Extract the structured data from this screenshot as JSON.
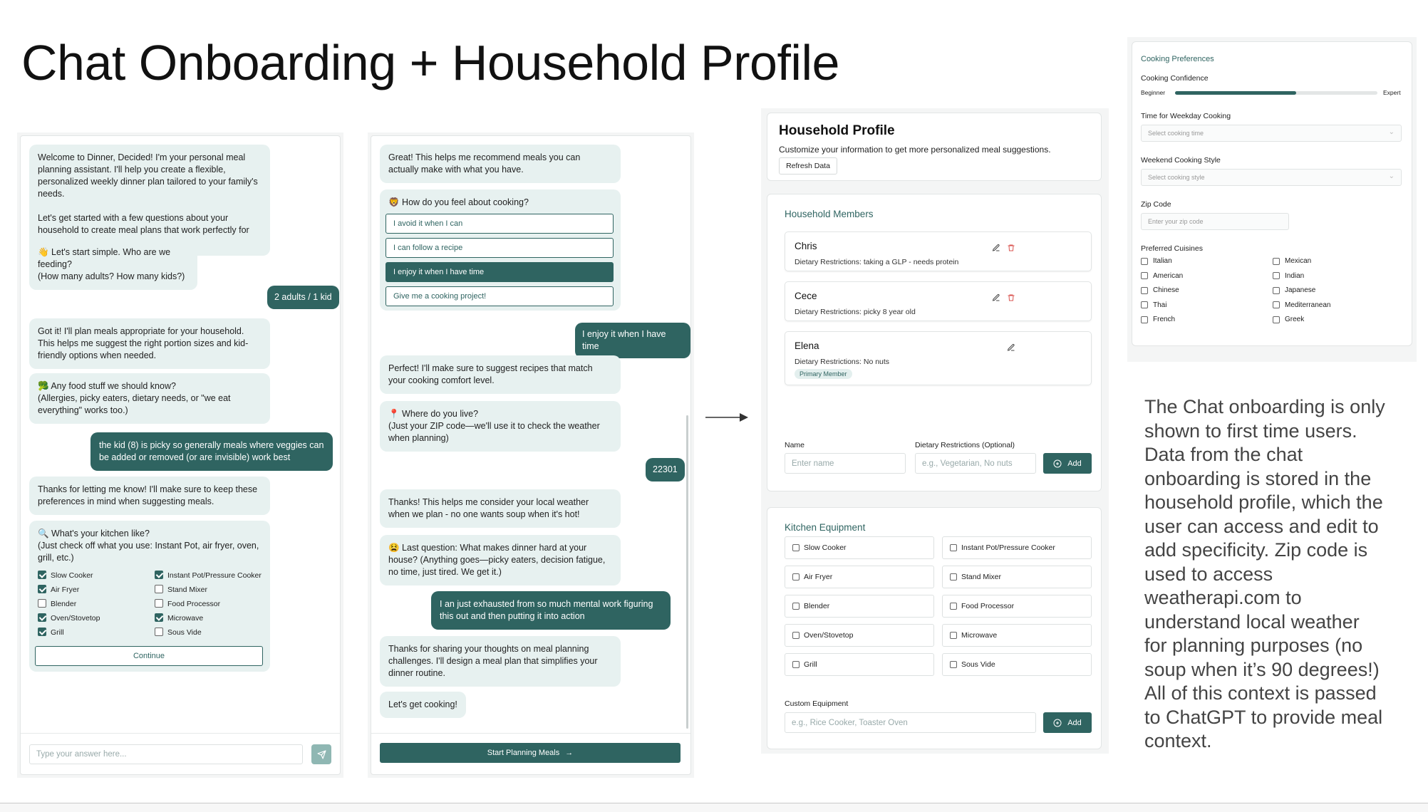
{
  "slide": {
    "title": "Chat Onboarding + Household Profile",
    "annotation": "The Chat onboarding is only shown to first time users. Data from the chat onboarding is stored in the household profile, which the user can access and edit to add specificity. Zip code is used to access weatherapi.com to understand local weather for planning purposes (no soup when it’s 90 degrees!) All of this context is passed to ChatGPT to provide meal context."
  },
  "chat1": {
    "welcome_p1": "Welcome to Dinner, Decided! I'm your personal meal planning assistant. I'll help you create a flexible, personalized weekly dinner plan tailored to your family's needs.",
    "welcome_p2": "Let's get started with a few questions about your household to create meal plans that work perfectly for you.",
    "feeding_q1": "👋 Let's start simple. Who are we feeding?",
    "feeding_q2": "(How many adults? How many kids?)",
    "answer_household": "2 adults / 1 kid",
    "household_ack": "Got it! I'll plan meals appropriate for your household. This helps me suggest the right portion sizes and kid-friendly options when needed.",
    "food_q1": "🥦 Any food stuff we should know?",
    "food_q2": "(Allergies, picky eaters, dietary needs, or \"we eat everything\" works too.)",
    "answer_food": "the kid (8) is picky so generally meals where veggies can be added or removed (or are invisible) work best",
    "food_ack": "Thanks for letting me know! I'll make sure to keep these preferences in mind when suggesting meals.",
    "kitchen_q1": "🔍 What's your kitchen like?",
    "kitchen_q2": "(Just check off what you use: Instant Pot, air fryer, oven, grill, etc.)",
    "equipment": [
      {
        "label": "Slow Cooker",
        "checked": true
      },
      {
        "label": "Instant Pot/Pressure Cooker",
        "checked": true
      },
      {
        "label": "Air Fryer",
        "checked": true
      },
      {
        "label": "Stand Mixer",
        "checked": false
      },
      {
        "label": "Blender",
        "checked": false
      },
      {
        "label": "Food Processor",
        "checked": false
      },
      {
        "label": "Oven/Stovetop",
        "checked": true
      },
      {
        "label": "Microwave",
        "checked": true
      },
      {
        "label": "Grill",
        "checked": true
      },
      {
        "label": "Sous Vide",
        "checked": false
      }
    ],
    "continue_label": "Continue",
    "input_placeholder": "Type your answer here...",
    "send_icon": "send-icon"
  },
  "chat2": {
    "intro": "Great! This helps me recommend meals you can actually make with what you have.",
    "cooking_q": "🦁 How do you feel about cooking?",
    "cooking_options": [
      {
        "label": "I avoid it when I can",
        "selected": false
      },
      {
        "label": "I can follow a recipe",
        "selected": false
      },
      {
        "label": "I enjoy it when I have time",
        "selected": true
      },
      {
        "label": "Give me a cooking project!",
        "selected": false
      }
    ],
    "answer_cooking": "I enjoy it when I have time",
    "cooking_ack": "Perfect! I'll make sure to suggest recipes that match your cooking comfort level.",
    "zip_q1": "📍 Where do you live?",
    "zip_q2": "(Just your ZIP code—we'll use it to check the weather when planning)",
    "answer_zip": "22301",
    "zip_ack": "Thanks! This helps me consider your local weather when we plan - no one wants soup when it's hot!",
    "last_q": "😫 Last question: What makes dinner hard at your house? (Anything goes—picky eaters, decision fatigue, no time, just tired. We get it.)",
    "answer_last": "I an just exhausted from so much mental work figuring this out and then putting it into action",
    "last_ack": "Thanks for sharing your thoughts on meal planning challenges. I'll design a meal plan that simplifies your dinner routine.",
    "final_msg": "Let's get cooking!",
    "start_label": "Start Planning Meals",
    "start_arrow": "→"
  },
  "profile": {
    "title": "Household Profile",
    "subtitle": "Customize your information to get more personalized meal suggestions.",
    "refresh_label": "Refresh Data",
    "members_title": "Household Members",
    "members": [
      {
        "name": "Chris",
        "diet": "Dietary Restrictions: taking a GLP - needs protein",
        "deletable": true
      },
      {
        "name": "Cece",
        "diet": "Dietary Restrictions: picky 8 year old",
        "deletable": true
      },
      {
        "name": "Elena",
        "diet": "Dietary Restrictions: No nuts",
        "badge": "Primary Member",
        "deletable": false
      }
    ],
    "name_label": "Name",
    "name_placeholder": "Enter name",
    "diet_label": "Dietary Restrictions (Optional)",
    "diet_placeholder": "e.g., Vegetarian, No nuts",
    "add_label": "Add",
    "equipment_title": "Kitchen Equipment",
    "equipment": [
      "Slow Cooker",
      "Instant Pot/Pressure Cooker",
      "Air Fryer",
      "Stand Mixer",
      "Blender",
      "Food Processor",
      "Oven/Stovetop",
      "Microwave",
      "Grill",
      "Sous Vide"
    ],
    "custom_label": "Custom Equipment",
    "custom_placeholder": "e.g., Rice Cooker, Toaster Oven",
    "custom_add_label": "Add"
  },
  "prefs": {
    "title": "Cooking Preferences",
    "confidence_label": "Cooking Confidence",
    "beginner": "Beginner",
    "expert": "Expert",
    "confidence_fraction": 0.6,
    "weekday_label": "Time for Weekday Cooking",
    "weekday_placeholder": "Select cooking time",
    "weekend_label": "Weekend Cooking Style",
    "weekend_placeholder": "Select cooking style",
    "zip_label": "Zip Code",
    "zip_placeholder": "Enter your zip code",
    "cuisines_label": "Preferred Cuisines",
    "cuisines": [
      "Italian",
      "Mexican",
      "American",
      "Indian",
      "Chinese",
      "Japanese",
      "Thai",
      "Mediterranean",
      "French",
      "Greek"
    ]
  },
  "colors": {
    "accent": "#2f6461",
    "bubble": "#e7f1f0",
    "danger": "#d9534f"
  }
}
